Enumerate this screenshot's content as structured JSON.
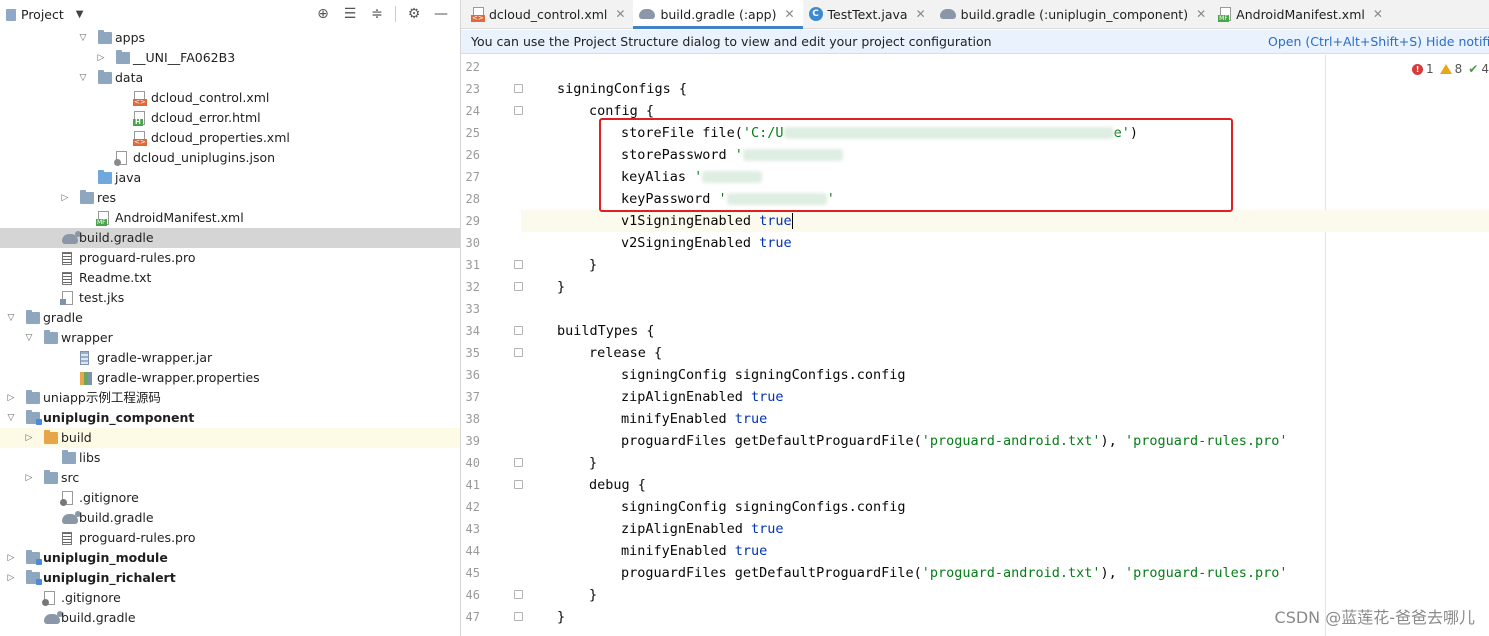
{
  "project_panel": {
    "title": "Project",
    "tree": [
      {
        "label": "apps",
        "indent": 4,
        "arrow": "down",
        "icon": "folder"
      },
      {
        "label": "__UNI__FA062B3",
        "indent": 5,
        "arrow": "right",
        "icon": "folder"
      },
      {
        "label": "data",
        "indent": 4,
        "arrow": "down",
        "icon": "folder"
      },
      {
        "label": "dcloud_control.xml",
        "indent": 6,
        "arrow": "",
        "icon": "xml"
      },
      {
        "label": "dcloud_error.html",
        "indent": 6,
        "arrow": "",
        "icon": "html"
      },
      {
        "label": "dcloud_properties.xml",
        "indent": 6,
        "arrow": "",
        "icon": "xml"
      },
      {
        "label": "dcloud_uniplugins.json",
        "indent": 5,
        "arrow": "",
        "icon": "json"
      },
      {
        "label": "java",
        "indent": 4,
        "arrow": "",
        "icon": "folder-blue"
      },
      {
        "label": "res",
        "indent": 3,
        "arrow": "right",
        "icon": "folder"
      },
      {
        "label": "AndroidManifest.xml",
        "indent": 4,
        "arrow": "",
        "icon": "mf"
      },
      {
        "label": "build.gradle",
        "indent": 2,
        "arrow": "",
        "icon": "gradle",
        "selected": true
      },
      {
        "label": "proguard-rules.pro",
        "indent": 2,
        "arrow": "",
        "icon": "text"
      },
      {
        "label": "Readme.txt",
        "indent": 2,
        "arrow": "",
        "icon": "text"
      },
      {
        "label": "test.jks",
        "indent": 2,
        "arrow": "",
        "icon": "keystore"
      },
      {
        "label": "gradle",
        "indent": 0,
        "arrow": "down",
        "icon": "folder"
      },
      {
        "label": "wrapper",
        "indent": 1,
        "arrow": "down",
        "icon": "folder"
      },
      {
        "label": "gradle-wrapper.jar",
        "indent": 3,
        "arrow": "",
        "icon": "jar"
      },
      {
        "label": "gradle-wrapper.properties",
        "indent": 3,
        "arrow": "",
        "icon": "props"
      },
      {
        "label": "uniapp示例工程源码",
        "indent": 0,
        "arrow": "right",
        "icon": "folder"
      },
      {
        "label": "uniplugin_component",
        "indent": 0,
        "arrow": "down",
        "icon": "folder-mod",
        "bold": true
      },
      {
        "label": "build",
        "indent": 1,
        "arrow": "right",
        "icon": "folder-orange",
        "highlight": true
      },
      {
        "label": "libs",
        "indent": 2,
        "arrow": "",
        "icon": "folder"
      },
      {
        "label": "src",
        "indent": 1,
        "arrow": "right",
        "icon": "folder"
      },
      {
        "label": ".gitignore",
        "indent": 2,
        "arrow": "",
        "icon": "ignore"
      },
      {
        "label": "build.gradle",
        "indent": 2,
        "arrow": "",
        "icon": "gradle"
      },
      {
        "label": "proguard-rules.pro",
        "indent": 2,
        "arrow": "",
        "icon": "text"
      },
      {
        "label": "uniplugin_module",
        "indent": 0,
        "arrow": "right",
        "icon": "folder-mod",
        "bold": true
      },
      {
        "label": "uniplugin_richalert",
        "indent": 0,
        "arrow": "right",
        "icon": "folder-mod",
        "bold": true
      },
      {
        "label": ".gitignore",
        "indent": 1,
        "arrow": "",
        "icon": "ignore"
      },
      {
        "label": "build.gradle",
        "indent": 1,
        "arrow": "",
        "icon": "gradle"
      }
    ]
  },
  "tabs": [
    {
      "label": "dcloud_control.xml",
      "icon": "xml",
      "active": false
    },
    {
      "label": "build.gradle (:app)",
      "icon": "gradle",
      "active": true
    },
    {
      "label": "TestText.java",
      "icon": "class",
      "active": false
    },
    {
      "label": "build.gradle (:uniplugin_component)",
      "icon": "gradle",
      "active": false
    },
    {
      "label": "AndroidManifest.xml",
      "icon": "mf",
      "active": false
    }
  ],
  "banner": {
    "message": "You can use the Project Structure dialog to view and edit your project configuration",
    "open_link": "Open (Ctrl+Alt+Shift+S)",
    "hide_link": "Hide notific"
  },
  "inspections": {
    "errors": "1",
    "warnings": "8",
    "ok": "4"
  },
  "code": {
    "current_line": 29,
    "lines": [
      {
        "n": 22,
        "indent": 0,
        "parts": []
      },
      {
        "n": 23,
        "indent": 1,
        "fold": true,
        "parts": [
          {
            "t": "signingConfigs {"
          }
        ]
      },
      {
        "n": 24,
        "indent": 2,
        "fold": true,
        "parts": [
          {
            "t": "config {"
          }
        ]
      },
      {
        "n": 25,
        "indent": 3,
        "parts": [
          {
            "t": "storeFile file("
          },
          {
            "t": "'C:/U",
            "c": "str"
          },
          {
            "blur": 330
          },
          {
            "t": "e'",
            "c": "str"
          },
          {
            "t": ")"
          }
        ]
      },
      {
        "n": 26,
        "indent": 3,
        "parts": [
          {
            "t": "storePassword "
          },
          {
            "t": "'",
            "c": "str"
          },
          {
            "blur": 100
          }
        ]
      },
      {
        "n": 27,
        "indent": 3,
        "parts": [
          {
            "t": "keyAlias "
          },
          {
            "t": "'",
            "c": "str"
          },
          {
            "blur": 60
          }
        ]
      },
      {
        "n": 28,
        "indent": 3,
        "parts": [
          {
            "t": "keyPassword "
          },
          {
            "t": "'",
            "c": "str"
          },
          {
            "blur": 100
          },
          {
            "t": "'",
            "c": "str"
          }
        ]
      },
      {
        "n": 29,
        "indent": 3,
        "parts": [
          {
            "t": "v1SigningEnabled "
          },
          {
            "t": "true",
            "c": "kw"
          },
          {
            "caret": true
          }
        ]
      },
      {
        "n": 30,
        "indent": 3,
        "parts": [
          {
            "t": "v2SigningEnabled "
          },
          {
            "t": "true",
            "c": "kw"
          }
        ]
      },
      {
        "n": 31,
        "indent": 2,
        "fold": true,
        "parts": [
          {
            "t": "}"
          }
        ]
      },
      {
        "n": 32,
        "indent": 1,
        "fold": true,
        "parts": [
          {
            "t": "}"
          }
        ]
      },
      {
        "n": 33,
        "indent": 0,
        "parts": []
      },
      {
        "n": 34,
        "indent": 1,
        "fold": true,
        "parts": [
          {
            "t": "buildTypes {"
          }
        ]
      },
      {
        "n": 35,
        "indent": 2,
        "fold": true,
        "parts": [
          {
            "t": "release {"
          }
        ]
      },
      {
        "n": 36,
        "indent": 3,
        "parts": [
          {
            "t": "signingConfig signingConfigs.config"
          }
        ]
      },
      {
        "n": 37,
        "indent": 3,
        "parts": [
          {
            "t": "zipAlignEnabled "
          },
          {
            "t": "true",
            "c": "kw"
          }
        ]
      },
      {
        "n": 38,
        "indent": 3,
        "parts": [
          {
            "t": "minifyEnabled "
          },
          {
            "t": "true",
            "c": "kw"
          }
        ]
      },
      {
        "n": 39,
        "indent": 3,
        "parts": [
          {
            "t": "proguardFiles getDefaultProguardFile("
          },
          {
            "t": "'proguard-android.txt'",
            "c": "str"
          },
          {
            "t": "), "
          },
          {
            "t": "'proguard-rules.pro'",
            "c": "str"
          }
        ]
      },
      {
        "n": 40,
        "indent": 2,
        "fold": true,
        "parts": [
          {
            "t": "}"
          }
        ]
      },
      {
        "n": 41,
        "indent": 2,
        "fold": true,
        "parts": [
          {
            "t": "debug {"
          }
        ]
      },
      {
        "n": 42,
        "indent": 3,
        "parts": [
          {
            "t": "signingConfig signingConfigs.config"
          }
        ]
      },
      {
        "n": 43,
        "indent": 3,
        "parts": [
          {
            "t": "zipAlignEnabled "
          },
          {
            "t": "true",
            "c": "kw"
          }
        ]
      },
      {
        "n": 44,
        "indent": 3,
        "parts": [
          {
            "t": "minifyEnabled "
          },
          {
            "t": "true",
            "c": "kw"
          }
        ]
      },
      {
        "n": 45,
        "indent": 3,
        "parts": [
          {
            "t": "proguardFiles getDefaultProguardFile("
          },
          {
            "t": "'proguard-android.txt'",
            "c": "str"
          },
          {
            "t": "), "
          },
          {
            "t": "'proguard-rules.pro'",
            "c": "str"
          }
        ]
      },
      {
        "n": 46,
        "indent": 2,
        "fold": true,
        "parts": [
          {
            "t": "}"
          }
        ]
      },
      {
        "n": 47,
        "indent": 1,
        "fold": true,
        "parts": [
          {
            "t": "}"
          }
        ]
      }
    ]
  },
  "watermark": "CSDN @蓝莲花-爸爸去哪儿",
  "colors": {
    "keyword": "#0033b3",
    "string": "#067d17",
    "highlight_box": "#e02020",
    "link": "#2c6dc4",
    "tab_active_underline": "#4083c9"
  }
}
